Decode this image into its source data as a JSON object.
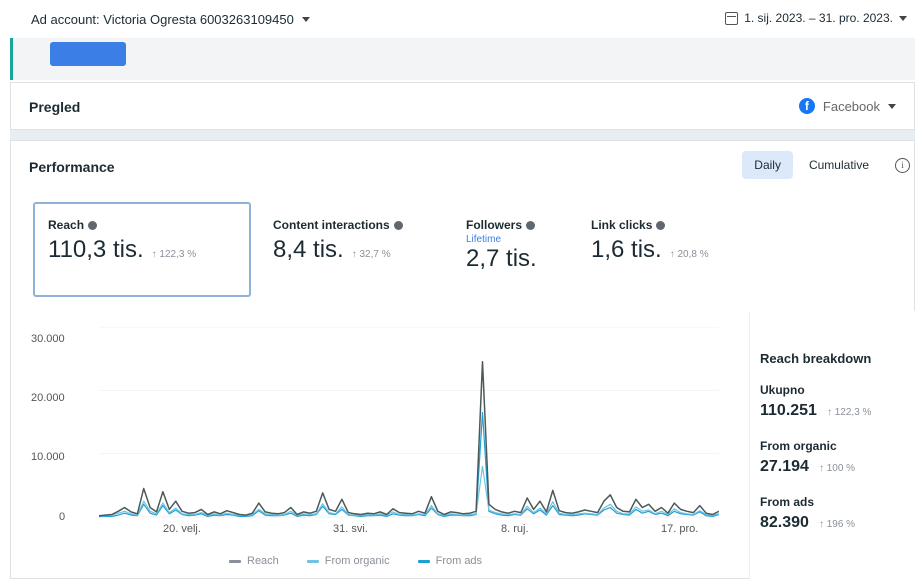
{
  "topbar": {
    "account_label": "Ad account: Victoria Ogresta 6003263109450",
    "date_range": "1. sij. 2023. – 31. pro. 2023."
  },
  "strip": {
    "button_label": ""
  },
  "overview": {
    "title": "Pregled",
    "platform": "Facebook"
  },
  "performance": {
    "title": "Performance",
    "toggle": {
      "daily": "Daily",
      "cumulative": "Cumulative",
      "selected": "daily"
    },
    "metrics": [
      {
        "label": "Reach",
        "value": "110,3 tis.",
        "change": "↑ 122,3 %",
        "sub": ""
      },
      {
        "label": "Content interactions",
        "value": "8,4 tis.",
        "change": "↑ 32,7 %",
        "sub": ""
      },
      {
        "label": "Followers",
        "value": "2,7 tis.",
        "change": "",
        "sub": "Lifetime"
      },
      {
        "label": "Link clicks",
        "value": "1,6 tis.",
        "change": "↑ 20,8 %",
        "sub": ""
      }
    ]
  },
  "chart_data": {
    "type": "line",
    "ylim": [
      0,
      30000
    ],
    "yticks": [
      "30.000",
      "20.000",
      "10.000",
      "0"
    ],
    "xticks": [
      "20. velj.",
      "31. svi.",
      "8. ruj.",
      "17. pro."
    ],
    "series": [
      {
        "name": "Reach",
        "color": "#4a5a5a",
        "values": [
          200,
          300,
          400,
          900,
          1500,
          800,
          500,
          4500,
          1500,
          800,
          4000,
          1200,
          2500,
          900,
          600,
          700,
          1200,
          400,
          800,
          500,
          1000,
          700,
          400,
          300,
          600,
          2200,
          800,
          600,
          500,
          700,
          1500,
          400,
          800,
          600,
          900,
          3800,
          1200,
          900,
          2800,
          700,
          500,
          400,
          600,
          500,
          800,
          400,
          1300,
          700,
          600,
          500,
          900,
          600,
          3200,
          900,
          400,
          800,
          700,
          500,
          600,
          900,
          24500,
          2000,
          1200,
          800,
          600,
          900,
          700,
          3000,
          1200,
          2500,
          800,
          4200,
          1000,
          700,
          600,
          800,
          1100,
          900,
          700,
          2500,
          3500,
          1500,
          900,
          800,
          2800,
          1500,
          2000,
          900,
          1500,
          600,
          2200,
          1200,
          900,
          700,
          1800,
          600,
          400,
          900
        ],
        "lw": 1.5
      },
      {
        "name": "From organic",
        "color": "#6fc3e0",
        "values": [
          150,
          200,
          300,
          600,
          900,
          500,
          300,
          2500,
          900,
          500,
          2200,
          700,
          1400,
          500,
          400,
          400,
          700,
          300,
          500,
          300,
          600,
          400,
          300,
          200,
          400,
          1200,
          500,
          400,
          300,
          400,
          900,
          300,
          500,
          400,
          500,
          2100,
          700,
          500,
          1600,
          400,
          300,
          300,
          400,
          300,
          500,
          300,
          800,
          400,
          400,
          300,
          500,
          400,
          1800,
          500,
          300,
          500,
          400,
          300,
          400,
          500,
          8000,
          1100,
          700,
          500,
          400,
          500,
          400,
          1700,
          700,
          1400,
          500,
          2400,
          600,
          400,
          400,
          500,
          600,
          500,
          400,
          1400,
          2000,
          900,
          500,
          500,
          1600,
          900,
          1100,
          500,
          900,
          400,
          1300,
          700,
          500,
          400,
          1000,
          400,
          300,
          500
        ],
        "lw": 1.2
      },
      {
        "name": "From ads",
        "color": "#1f9fd6",
        "values": [
          50,
          100,
          100,
          300,
          600,
          300,
          200,
          2000,
          600,
          300,
          1800,
          500,
          1100,
          400,
          200,
          300,
          500,
          100,
          300,
          200,
          400,
          300,
          100,
          100,
          200,
          1000,
          300,
          200,
          200,
          300,
          600,
          100,
          300,
          200,
          400,
          1700,
          500,
          400,
          1200,
          300,
          200,
          100,
          200,
          200,
          300,
          100,
          500,
          300,
          200,
          200,
          400,
          200,
          1400,
          400,
          100,
          300,
          300,
          200,
          200,
          400,
          16500,
          900,
          500,
          300,
          200,
          400,
          300,
          1300,
          500,
          1100,
          300,
          1800,
          400,
          300,
          200,
          300,
          500,
          400,
          300,
          1100,
          1500,
          600,
          400,
          300,
          1200,
          600,
          900,
          400,
          600,
          200,
          900,
          500,
          400,
          300,
          800,
          200,
          100,
          400
        ],
        "lw": 1.2
      }
    ]
  },
  "breakdown": {
    "title": "Reach breakdown",
    "rows": [
      {
        "label": "Ukupno",
        "value": "110.251",
        "change": "↑ 122,3 %"
      },
      {
        "label": "From organic",
        "value": "27.194",
        "change": "↑ 100 %"
      },
      {
        "label": "From ads",
        "value": "82.390",
        "change": "↑ 196 %"
      }
    ]
  },
  "legend": [
    "Reach",
    "From organic",
    "From ads"
  ]
}
